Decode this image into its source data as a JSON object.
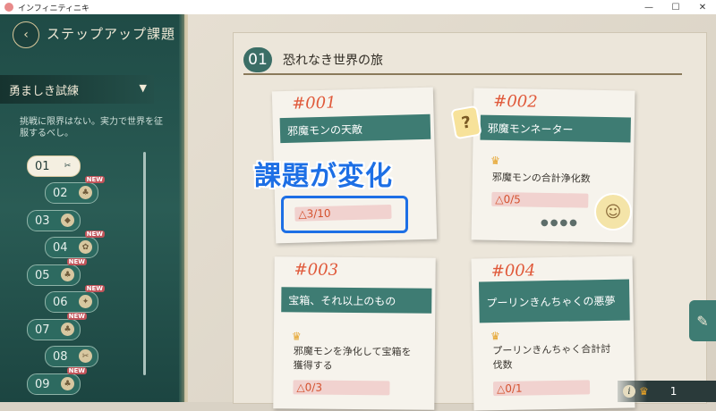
{
  "window": {
    "title": "インフィニティニキ",
    "controls": {
      "minimize": "—",
      "maximize": "☐",
      "close": "✕"
    }
  },
  "sidebar": {
    "title": "ステップアップ課題",
    "dropdown_label": "勇ましき試練",
    "description": "挑戦に限界はない。実力で世界を征服するべし。",
    "stages": [
      {
        "label": "01",
        "selected": true,
        "icon": "✂",
        "new": ""
      },
      {
        "label": "02",
        "selected": false,
        "icon": "♣",
        "new": "NEW"
      },
      {
        "label": "03",
        "selected": false,
        "icon": "◆",
        "new": ""
      },
      {
        "label": "04",
        "selected": false,
        "icon": "✿",
        "new": "NEW"
      },
      {
        "label": "05",
        "selected": false,
        "icon": "♣",
        "new": "NEW"
      },
      {
        "label": "06",
        "selected": false,
        "icon": "✦",
        "new": "NEW"
      },
      {
        "label": "07",
        "selected": false,
        "icon": "♣",
        "new": "NEW"
      },
      {
        "label": "08",
        "selected": false,
        "icon": "✂",
        "new": ""
      },
      {
        "label": "09",
        "selected": false,
        "icon": "♣",
        "new": "NEW"
      }
    ]
  },
  "main": {
    "section_number": "01",
    "section_title": "恐れなき世界の旅",
    "overlay_caption": "課題が変化",
    "cards": [
      {
        "number": "#001",
        "title": "邪魔モンの天敵",
        "task": "",
        "progress": "△3/10"
      },
      {
        "number": "#002",
        "title": "邪魔モンネーター",
        "task": "邪魔モンの合計浄化数",
        "progress": "△0/5"
      },
      {
        "number": "#003",
        "title": "宝箱、それ以上のもの",
        "task": "邪魔モンを浄化して宝箱を獲得する",
        "progress": "△0/3"
      },
      {
        "number": "#004",
        "title": "プーリンきんちゃくの悪夢",
        "task": "プーリンきんちゃく合計討伐数",
        "progress": "△0/1"
      }
    ],
    "carousel_dots": "●●●●"
  },
  "footer": {
    "crown_count": "1"
  },
  "colors": {
    "sidebar_bg": "#24504a",
    "card_tag": "#3e7c73",
    "card_number": "#e0593a",
    "highlight": "#1d6fe5"
  },
  "icons": {
    "back": "back-arrow-icon",
    "dropdown": "chevron-down-icon",
    "crown": "crown-icon",
    "question": "question-mark-icon",
    "edit": "edit-note-icon",
    "info": "info-icon"
  }
}
